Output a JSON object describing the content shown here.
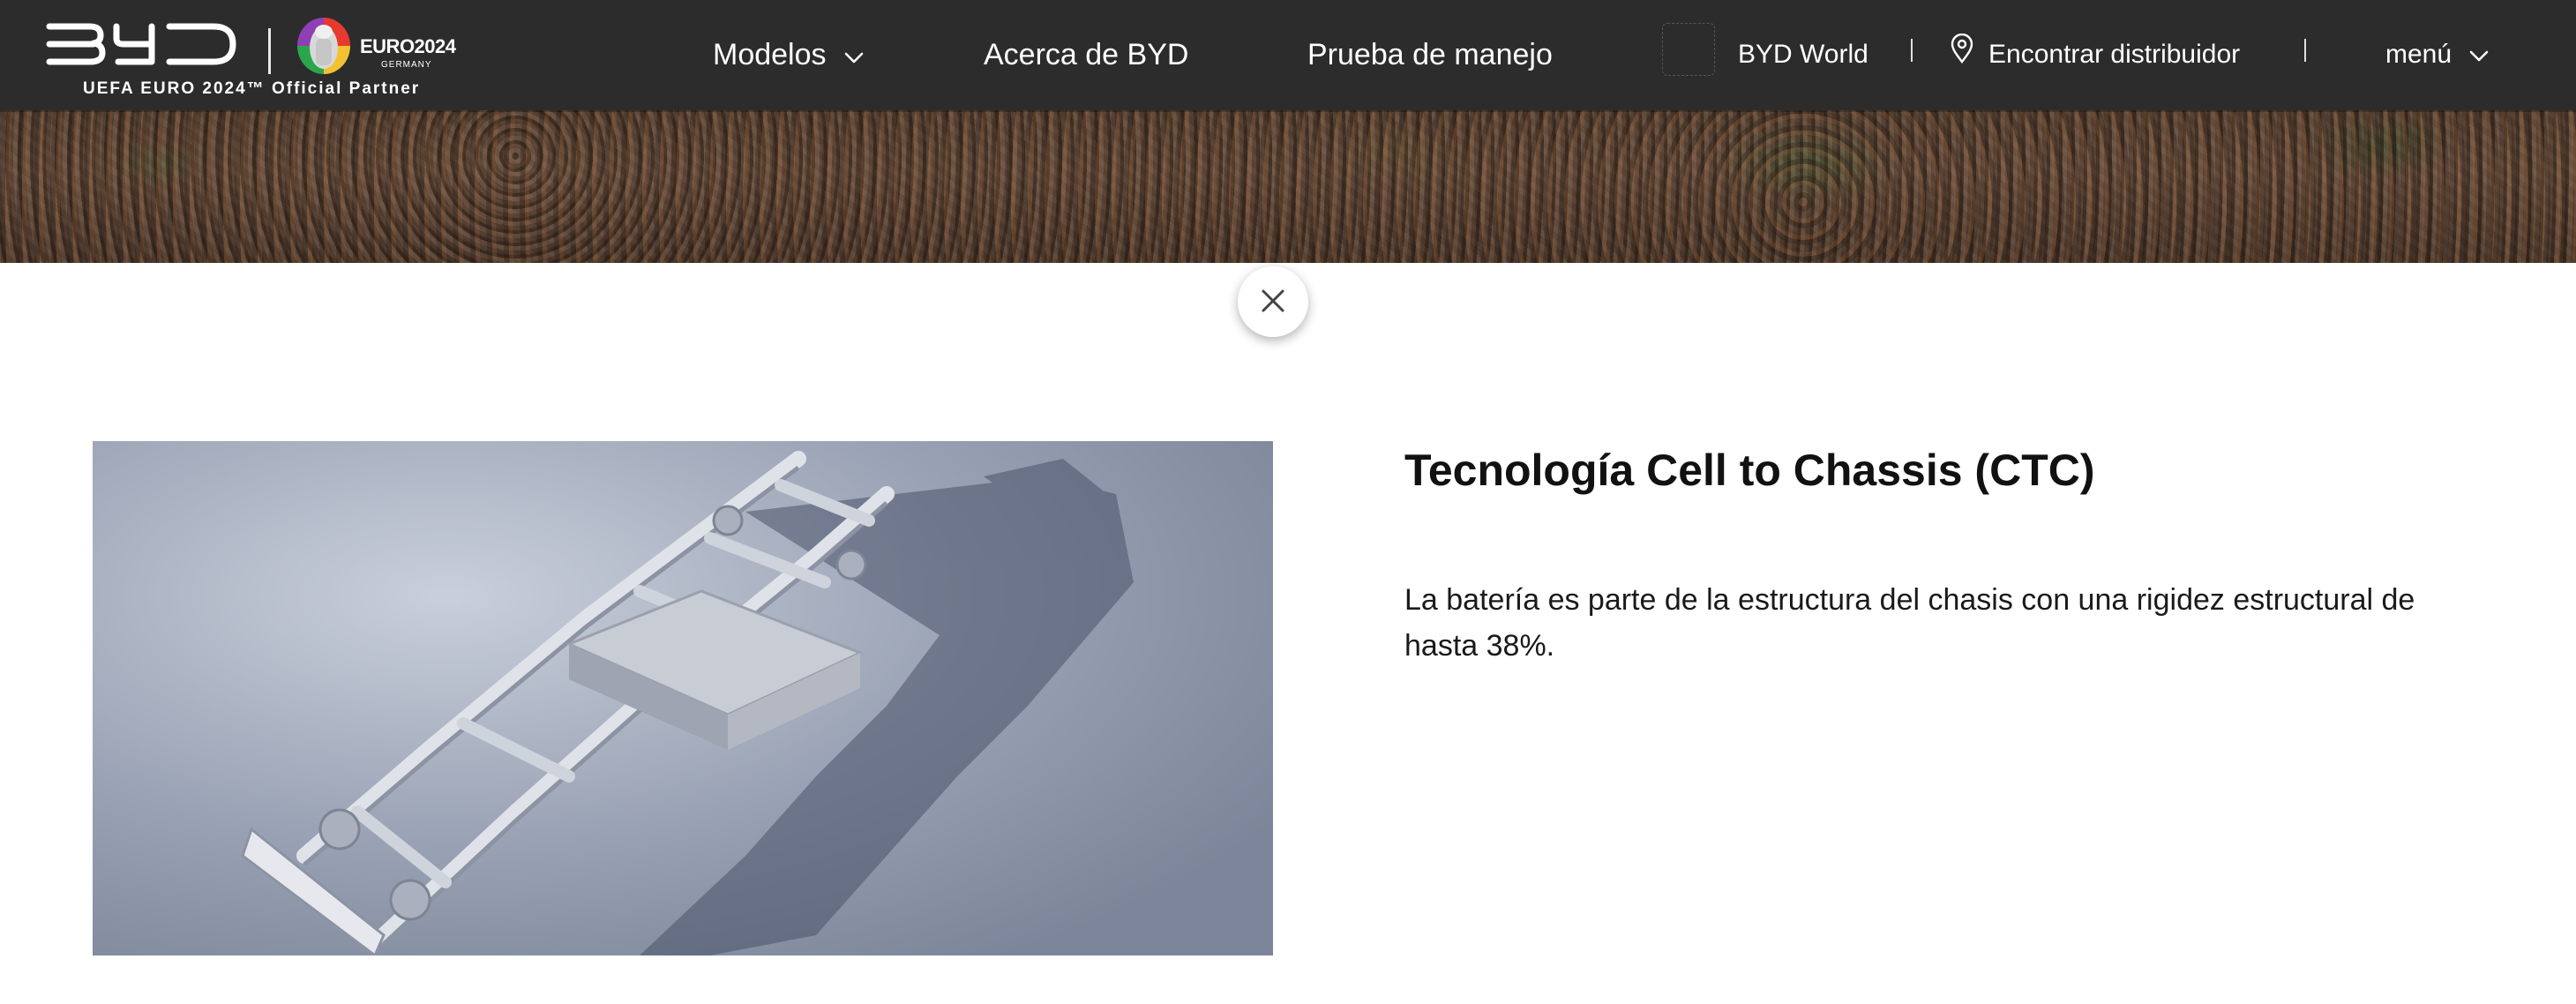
{
  "header": {
    "partner_text": "UEFA EURO 2024™ Official Partner",
    "euro_text": "EURO2024",
    "euro_sub": "GERMANY",
    "nav": {
      "modelos": "Modelos",
      "acerca": "Acerca de BYD",
      "prueba": "Prueba de manejo",
      "world": "BYD World",
      "distribuidor": "Encontrar distribuidor",
      "menu": "menú"
    },
    "icons": {
      "logo": "byd-logo",
      "emblem": "euro-2024-emblem",
      "dropdown": "chevron-down-icon",
      "location": "location-pin-icon",
      "close": "close-icon"
    }
  },
  "feature": {
    "title": "Tecnología Cell to Chassis (CTC)",
    "description": "La batería es parte de la estructura del chasis con una rigidez estructural de hasta 38%.",
    "image_alt": "chassis-with-battery-image"
  },
  "colors": {
    "navbar_bg": "#2c2c2c",
    "nav_text": "#ffffff",
    "title_text": "#111111",
    "body_text": "#1a1a1a"
  }
}
